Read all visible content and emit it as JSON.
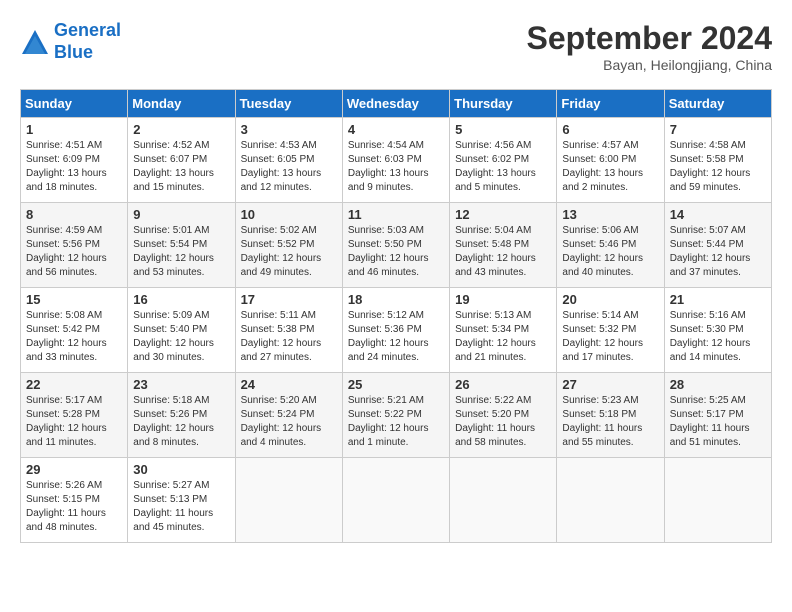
{
  "header": {
    "logo_line1": "General",
    "logo_line2": "Blue",
    "month": "September 2024",
    "location": "Bayan, Heilongjiang, China"
  },
  "weekdays": [
    "Sunday",
    "Monday",
    "Tuesday",
    "Wednesday",
    "Thursday",
    "Friday",
    "Saturday"
  ],
  "weeks": [
    [
      {
        "day": "1",
        "info": "Sunrise: 4:51 AM\nSunset: 6:09 PM\nDaylight: 13 hours\nand 18 minutes."
      },
      {
        "day": "2",
        "info": "Sunrise: 4:52 AM\nSunset: 6:07 PM\nDaylight: 13 hours\nand 15 minutes."
      },
      {
        "day": "3",
        "info": "Sunrise: 4:53 AM\nSunset: 6:05 PM\nDaylight: 13 hours\nand 12 minutes."
      },
      {
        "day": "4",
        "info": "Sunrise: 4:54 AM\nSunset: 6:03 PM\nDaylight: 13 hours\nand 9 minutes."
      },
      {
        "day": "5",
        "info": "Sunrise: 4:56 AM\nSunset: 6:02 PM\nDaylight: 13 hours\nand 5 minutes."
      },
      {
        "day": "6",
        "info": "Sunrise: 4:57 AM\nSunset: 6:00 PM\nDaylight: 13 hours\nand 2 minutes."
      },
      {
        "day": "7",
        "info": "Sunrise: 4:58 AM\nSunset: 5:58 PM\nDaylight: 12 hours\nand 59 minutes."
      }
    ],
    [
      {
        "day": "8",
        "info": "Sunrise: 4:59 AM\nSunset: 5:56 PM\nDaylight: 12 hours\nand 56 minutes."
      },
      {
        "day": "9",
        "info": "Sunrise: 5:01 AM\nSunset: 5:54 PM\nDaylight: 12 hours\nand 53 minutes."
      },
      {
        "day": "10",
        "info": "Sunrise: 5:02 AM\nSunset: 5:52 PM\nDaylight: 12 hours\nand 49 minutes."
      },
      {
        "day": "11",
        "info": "Sunrise: 5:03 AM\nSunset: 5:50 PM\nDaylight: 12 hours\nand 46 minutes."
      },
      {
        "day": "12",
        "info": "Sunrise: 5:04 AM\nSunset: 5:48 PM\nDaylight: 12 hours\nand 43 minutes."
      },
      {
        "day": "13",
        "info": "Sunrise: 5:06 AM\nSunset: 5:46 PM\nDaylight: 12 hours\nand 40 minutes."
      },
      {
        "day": "14",
        "info": "Sunrise: 5:07 AM\nSunset: 5:44 PM\nDaylight: 12 hours\nand 37 minutes."
      }
    ],
    [
      {
        "day": "15",
        "info": "Sunrise: 5:08 AM\nSunset: 5:42 PM\nDaylight: 12 hours\nand 33 minutes."
      },
      {
        "day": "16",
        "info": "Sunrise: 5:09 AM\nSunset: 5:40 PM\nDaylight: 12 hours\nand 30 minutes."
      },
      {
        "day": "17",
        "info": "Sunrise: 5:11 AM\nSunset: 5:38 PM\nDaylight: 12 hours\nand 27 minutes."
      },
      {
        "day": "18",
        "info": "Sunrise: 5:12 AM\nSunset: 5:36 PM\nDaylight: 12 hours\nand 24 minutes."
      },
      {
        "day": "19",
        "info": "Sunrise: 5:13 AM\nSunset: 5:34 PM\nDaylight: 12 hours\nand 21 minutes."
      },
      {
        "day": "20",
        "info": "Sunrise: 5:14 AM\nSunset: 5:32 PM\nDaylight: 12 hours\nand 17 minutes."
      },
      {
        "day": "21",
        "info": "Sunrise: 5:16 AM\nSunset: 5:30 PM\nDaylight: 12 hours\nand 14 minutes."
      }
    ],
    [
      {
        "day": "22",
        "info": "Sunrise: 5:17 AM\nSunset: 5:28 PM\nDaylight: 12 hours\nand 11 minutes."
      },
      {
        "day": "23",
        "info": "Sunrise: 5:18 AM\nSunset: 5:26 PM\nDaylight: 12 hours\nand 8 minutes."
      },
      {
        "day": "24",
        "info": "Sunrise: 5:20 AM\nSunset: 5:24 PM\nDaylight: 12 hours\nand 4 minutes."
      },
      {
        "day": "25",
        "info": "Sunrise: 5:21 AM\nSunset: 5:22 PM\nDaylight: 12 hours\nand 1 minute."
      },
      {
        "day": "26",
        "info": "Sunrise: 5:22 AM\nSunset: 5:20 PM\nDaylight: 11 hours\nand 58 minutes."
      },
      {
        "day": "27",
        "info": "Sunrise: 5:23 AM\nSunset: 5:18 PM\nDaylight: 11 hours\nand 55 minutes."
      },
      {
        "day": "28",
        "info": "Sunrise: 5:25 AM\nSunset: 5:17 PM\nDaylight: 11 hours\nand 51 minutes."
      }
    ],
    [
      {
        "day": "29",
        "info": "Sunrise: 5:26 AM\nSunset: 5:15 PM\nDaylight: 11 hours\nand 48 minutes."
      },
      {
        "day": "30",
        "info": "Sunrise: 5:27 AM\nSunset: 5:13 PM\nDaylight: 11 hours\nand 45 minutes."
      },
      {
        "day": "",
        "info": ""
      },
      {
        "day": "",
        "info": ""
      },
      {
        "day": "",
        "info": ""
      },
      {
        "day": "",
        "info": ""
      },
      {
        "day": "",
        "info": ""
      }
    ]
  ]
}
